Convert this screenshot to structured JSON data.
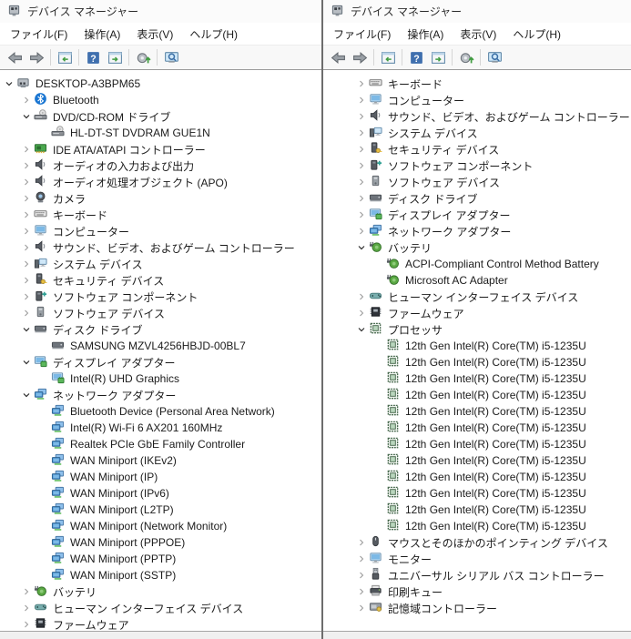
{
  "colors": {
    "window_border": "#6d6d6d",
    "toolbar_border": "#9c9c9c",
    "text": "#1b1b1b",
    "bluetooth_blue": "#1a76d2",
    "network_blue": "#4f9ad8",
    "device_green": "#4aa84e",
    "help_blue": "#3f6fae"
  },
  "windows": {
    "left": {
      "title": "デバイス マネージャー",
      "menu": [
        "ファイル(F)",
        "操作(A)",
        "表示(V)",
        "ヘルプ(H)"
      ],
      "toolbar": [
        {
          "name": "back-arrow"
        },
        {
          "name": "forward-arrow"
        },
        {
          "name": "separator"
        },
        {
          "name": "show-console-tree"
        },
        {
          "name": "separator"
        },
        {
          "name": "help"
        },
        {
          "name": "properties"
        },
        {
          "name": "separator"
        },
        {
          "name": "scan-hardware-changes"
        },
        {
          "name": "separator"
        },
        {
          "name": "search-computer"
        }
      ],
      "tree": [
        {
          "label": "DESKTOP-A3BPM65",
          "level": 0,
          "state": "expanded",
          "icon": "computer"
        },
        {
          "label": "Bluetooth",
          "level": 1,
          "state": "collapsed",
          "icon": "bluetooth"
        },
        {
          "label": "DVD/CD-ROM ドライブ",
          "level": 1,
          "state": "expanded",
          "icon": "cd-drive"
        },
        {
          "label": "HL-DT-ST DVDRAM GUE1N",
          "level": 2,
          "state": "none",
          "icon": "cd-drive"
        },
        {
          "label": "IDE ATA/ATAPI コントローラー",
          "level": 1,
          "state": "collapsed",
          "icon": "ide-controller"
        },
        {
          "label": "オーディオの入力および出力",
          "level": 1,
          "state": "collapsed",
          "icon": "audio"
        },
        {
          "label": "オーディオ処理オブジェクト (APO)",
          "level": 1,
          "state": "collapsed",
          "icon": "audio"
        },
        {
          "label": "カメラ",
          "level": 1,
          "state": "collapsed",
          "icon": "camera"
        },
        {
          "label": "キーボード",
          "level": 1,
          "state": "collapsed",
          "icon": "keyboard"
        },
        {
          "label": "コンピューター",
          "level": 1,
          "state": "collapsed",
          "icon": "monitor"
        },
        {
          "label": "サウンド、ビデオ、およびゲーム コントローラー",
          "level": 1,
          "state": "collapsed",
          "icon": "audio"
        },
        {
          "label": "システム デバイス",
          "level": 1,
          "state": "collapsed",
          "icon": "system-devices"
        },
        {
          "label": "セキュリティ デバイス",
          "level": 1,
          "state": "collapsed",
          "icon": "security"
        },
        {
          "label": "ソフトウェア コンポーネント",
          "level": 1,
          "state": "collapsed",
          "icon": "software-component"
        },
        {
          "label": "ソフトウェア デバイス",
          "level": 1,
          "state": "collapsed",
          "icon": "software-device"
        },
        {
          "label": "ディスク ドライブ",
          "level": 1,
          "state": "expanded",
          "icon": "disk-drive"
        },
        {
          "label": "SAMSUNG MZVL4256HBJD-00BL7",
          "level": 2,
          "state": "none",
          "icon": "disk-drive"
        },
        {
          "label": "ディスプレイ アダプター",
          "level": 1,
          "state": "expanded",
          "icon": "display-adapter"
        },
        {
          "label": "Intel(R) UHD Graphics",
          "level": 2,
          "state": "none",
          "icon": "display-adapter"
        },
        {
          "label": "ネットワーク アダプター",
          "level": 1,
          "state": "expanded",
          "icon": "network-adapter"
        },
        {
          "label": "Bluetooth Device (Personal Area Network)",
          "level": 2,
          "state": "none",
          "icon": "network-adapter"
        },
        {
          "label": "Intel(R) Wi-Fi 6 AX201 160MHz",
          "level": 2,
          "state": "none",
          "icon": "network-adapter"
        },
        {
          "label": "Realtek PCIe GbE Family Controller",
          "level": 2,
          "state": "none",
          "icon": "network-adapter"
        },
        {
          "label": "WAN Miniport (IKEv2)",
          "level": 2,
          "state": "none",
          "icon": "network-adapter"
        },
        {
          "label": "WAN Miniport (IP)",
          "level": 2,
          "state": "none",
          "icon": "network-adapter"
        },
        {
          "label": "WAN Miniport (IPv6)",
          "level": 2,
          "state": "none",
          "icon": "network-adapter"
        },
        {
          "label": "WAN Miniport (L2TP)",
          "level": 2,
          "state": "none",
          "icon": "network-adapter"
        },
        {
          "label": "WAN Miniport (Network Monitor)",
          "level": 2,
          "state": "none",
          "icon": "network-adapter"
        },
        {
          "label": "WAN Miniport (PPPOE)",
          "level": 2,
          "state": "none",
          "icon": "network-adapter"
        },
        {
          "label": "WAN Miniport (PPTP)",
          "level": 2,
          "state": "none",
          "icon": "network-adapter"
        },
        {
          "label": "WAN Miniport (SSTP)",
          "level": 2,
          "state": "none",
          "icon": "network-adapter"
        },
        {
          "label": "バッテリ",
          "level": 1,
          "state": "collapsed",
          "icon": "battery"
        },
        {
          "label": "ヒューマン インターフェイス デバイス",
          "level": 1,
          "state": "collapsed",
          "icon": "hid"
        },
        {
          "label": "ファームウェア",
          "level": 1,
          "state": "collapsed",
          "icon": "firmware"
        }
      ]
    },
    "right": {
      "title": "デバイス マネージャー",
      "menu": [
        "ファイル(F)",
        "操作(A)",
        "表示(V)",
        "ヘルプ(H)"
      ],
      "toolbar": [
        {
          "name": "back-arrow"
        },
        {
          "name": "forward-arrow"
        },
        {
          "name": "separator"
        },
        {
          "name": "show-console-tree"
        },
        {
          "name": "separator"
        },
        {
          "name": "help"
        },
        {
          "name": "properties"
        },
        {
          "name": "separator"
        },
        {
          "name": "scan-hardware-changes"
        },
        {
          "name": "separator"
        },
        {
          "name": "search-computer"
        }
      ],
      "tree": [
        {
          "label": "キーボード",
          "level": 1,
          "state": "collapsed",
          "icon": "keyboard"
        },
        {
          "label": "コンピューター",
          "level": 1,
          "state": "collapsed",
          "icon": "monitor"
        },
        {
          "label": "サウンド、ビデオ、およびゲーム コントローラー",
          "level": 1,
          "state": "collapsed",
          "icon": "audio"
        },
        {
          "label": "システム デバイス",
          "level": 1,
          "state": "collapsed",
          "icon": "system-devices"
        },
        {
          "label": "セキュリティ デバイス",
          "level": 1,
          "state": "collapsed",
          "icon": "security"
        },
        {
          "label": "ソフトウェア コンポーネント",
          "level": 1,
          "state": "collapsed",
          "icon": "software-component"
        },
        {
          "label": "ソフトウェア デバイス",
          "level": 1,
          "state": "collapsed",
          "icon": "software-device"
        },
        {
          "label": "ディスク ドライブ",
          "level": 1,
          "state": "collapsed",
          "icon": "disk-drive"
        },
        {
          "label": "ディスプレイ アダプター",
          "level": 1,
          "state": "collapsed",
          "icon": "display-adapter"
        },
        {
          "label": "ネットワーク アダプター",
          "level": 1,
          "state": "collapsed",
          "icon": "network-adapter"
        },
        {
          "label": "バッテリ",
          "level": 1,
          "state": "expanded",
          "icon": "battery"
        },
        {
          "label": "ACPI-Compliant Control Method Battery",
          "level": 2,
          "state": "none",
          "icon": "battery"
        },
        {
          "label": "Microsoft AC Adapter",
          "level": 2,
          "state": "none",
          "icon": "battery"
        },
        {
          "label": "ヒューマン インターフェイス デバイス",
          "level": 1,
          "state": "collapsed",
          "icon": "hid"
        },
        {
          "label": "ファームウェア",
          "level": 1,
          "state": "collapsed",
          "icon": "firmware"
        },
        {
          "label": "プロセッサ",
          "level": 1,
          "state": "expanded",
          "icon": "processor"
        },
        {
          "label": "12th Gen Intel(R) Core(TM) i5-1235U",
          "level": 2,
          "state": "none",
          "icon": "processor"
        },
        {
          "label": "12th Gen Intel(R) Core(TM) i5-1235U",
          "level": 2,
          "state": "none",
          "icon": "processor"
        },
        {
          "label": "12th Gen Intel(R) Core(TM) i5-1235U",
          "level": 2,
          "state": "none",
          "icon": "processor"
        },
        {
          "label": "12th Gen Intel(R) Core(TM) i5-1235U",
          "level": 2,
          "state": "none",
          "icon": "processor"
        },
        {
          "label": "12th Gen Intel(R) Core(TM) i5-1235U",
          "level": 2,
          "state": "none",
          "icon": "processor"
        },
        {
          "label": "12th Gen Intel(R) Core(TM) i5-1235U",
          "level": 2,
          "state": "none",
          "icon": "processor"
        },
        {
          "label": "12th Gen Intel(R) Core(TM) i5-1235U",
          "level": 2,
          "state": "none",
          "icon": "processor"
        },
        {
          "label": "12th Gen Intel(R) Core(TM) i5-1235U",
          "level": 2,
          "state": "none",
          "icon": "processor"
        },
        {
          "label": "12th Gen Intel(R) Core(TM) i5-1235U",
          "level": 2,
          "state": "none",
          "icon": "processor"
        },
        {
          "label": "12th Gen Intel(R) Core(TM) i5-1235U",
          "level": 2,
          "state": "none",
          "icon": "processor"
        },
        {
          "label": "12th Gen Intel(R) Core(TM) i5-1235U",
          "level": 2,
          "state": "none",
          "icon": "processor"
        },
        {
          "label": "12th Gen Intel(R) Core(TM) i5-1235U",
          "level": 2,
          "state": "none",
          "icon": "processor"
        },
        {
          "label": "マウスとそのほかのポインティング デバイス",
          "level": 1,
          "state": "collapsed",
          "icon": "mouse"
        },
        {
          "label": "モニター",
          "level": 1,
          "state": "collapsed",
          "icon": "monitor"
        },
        {
          "label": "ユニバーサル シリアル バス コントローラー",
          "level": 1,
          "state": "collapsed",
          "icon": "usb"
        },
        {
          "label": "印刷キュー",
          "level": 1,
          "state": "collapsed",
          "icon": "printer"
        },
        {
          "label": "記憶域コントローラー",
          "level": 1,
          "state": "collapsed",
          "icon": "storage-controller"
        }
      ]
    }
  }
}
